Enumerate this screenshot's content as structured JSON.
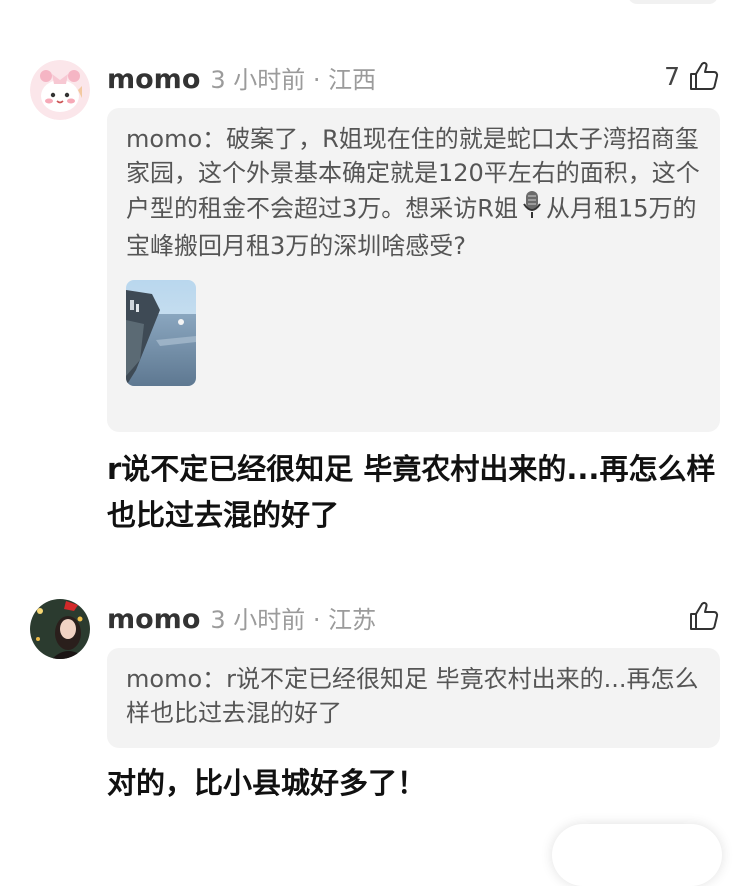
{
  "comments": [
    {
      "user": "momo",
      "time_location": "3 小时前 · 江西",
      "likes": "7",
      "avatar_icon": "pink-cartoon-avatar-icon",
      "quote": {
        "name": "momo：",
        "text_part1": "破案了，R姐现在住的就是蛇口太子湾招商玺家园，这个外景基本确定就是120平左右的面积，这个户型的租金不会超过3万。想采访R姐",
        "emoji": "microphone-icon",
        "text_part2": "从月租15万的宝峰搬回月租3万的深圳啥感受?"
      },
      "reply": "r说不定已经很知足 毕竟农村出来的...再怎么样也比过去混的好了"
    },
    {
      "user": "momo",
      "time_location": "3 小时前 · 江苏",
      "likes": "",
      "avatar_icon": "christmas-photo-avatar-icon",
      "quote": {
        "name": "momo：",
        "text": "r说不定已经很知足 毕竟农村出来的...再怎么样也比过去混的好了"
      },
      "reply": "对的，比小县城好多了！"
    }
  ]
}
